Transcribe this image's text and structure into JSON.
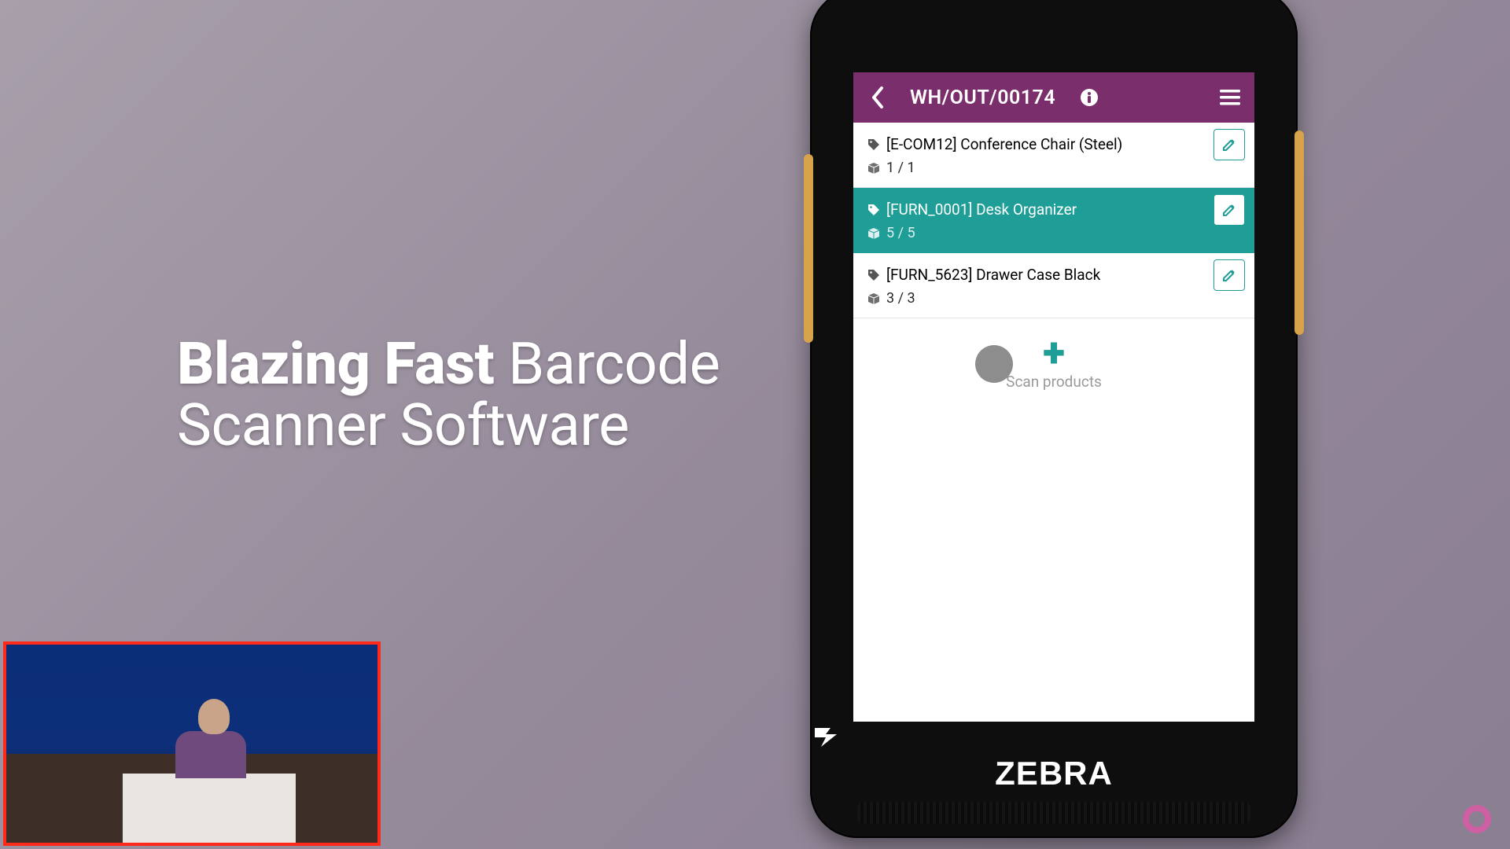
{
  "headline": {
    "bold": "Blazing Fast",
    "light_part1": "Barcode",
    "light_part2": "Scanner Software"
  },
  "device": {
    "brand": "ZEBRA"
  },
  "app": {
    "header": {
      "title": "WH/OUT/00174"
    },
    "scan_label": "Scan products",
    "rows": [
      {
        "label": "[E-COM12] Conference Chair (Steel)",
        "qty": "1 / 1",
        "selected": false
      },
      {
        "label": "[FURN_0001] Desk Organizer",
        "qty": "5 / 5",
        "selected": true
      },
      {
        "label": "[FURN_5623] Drawer Case Black",
        "qty": "3 / 3",
        "selected": false
      }
    ]
  },
  "colors": {
    "purple": "#7a2f6c",
    "teal": "#1f9e97",
    "odoo_pink": "#cf5fa3"
  }
}
